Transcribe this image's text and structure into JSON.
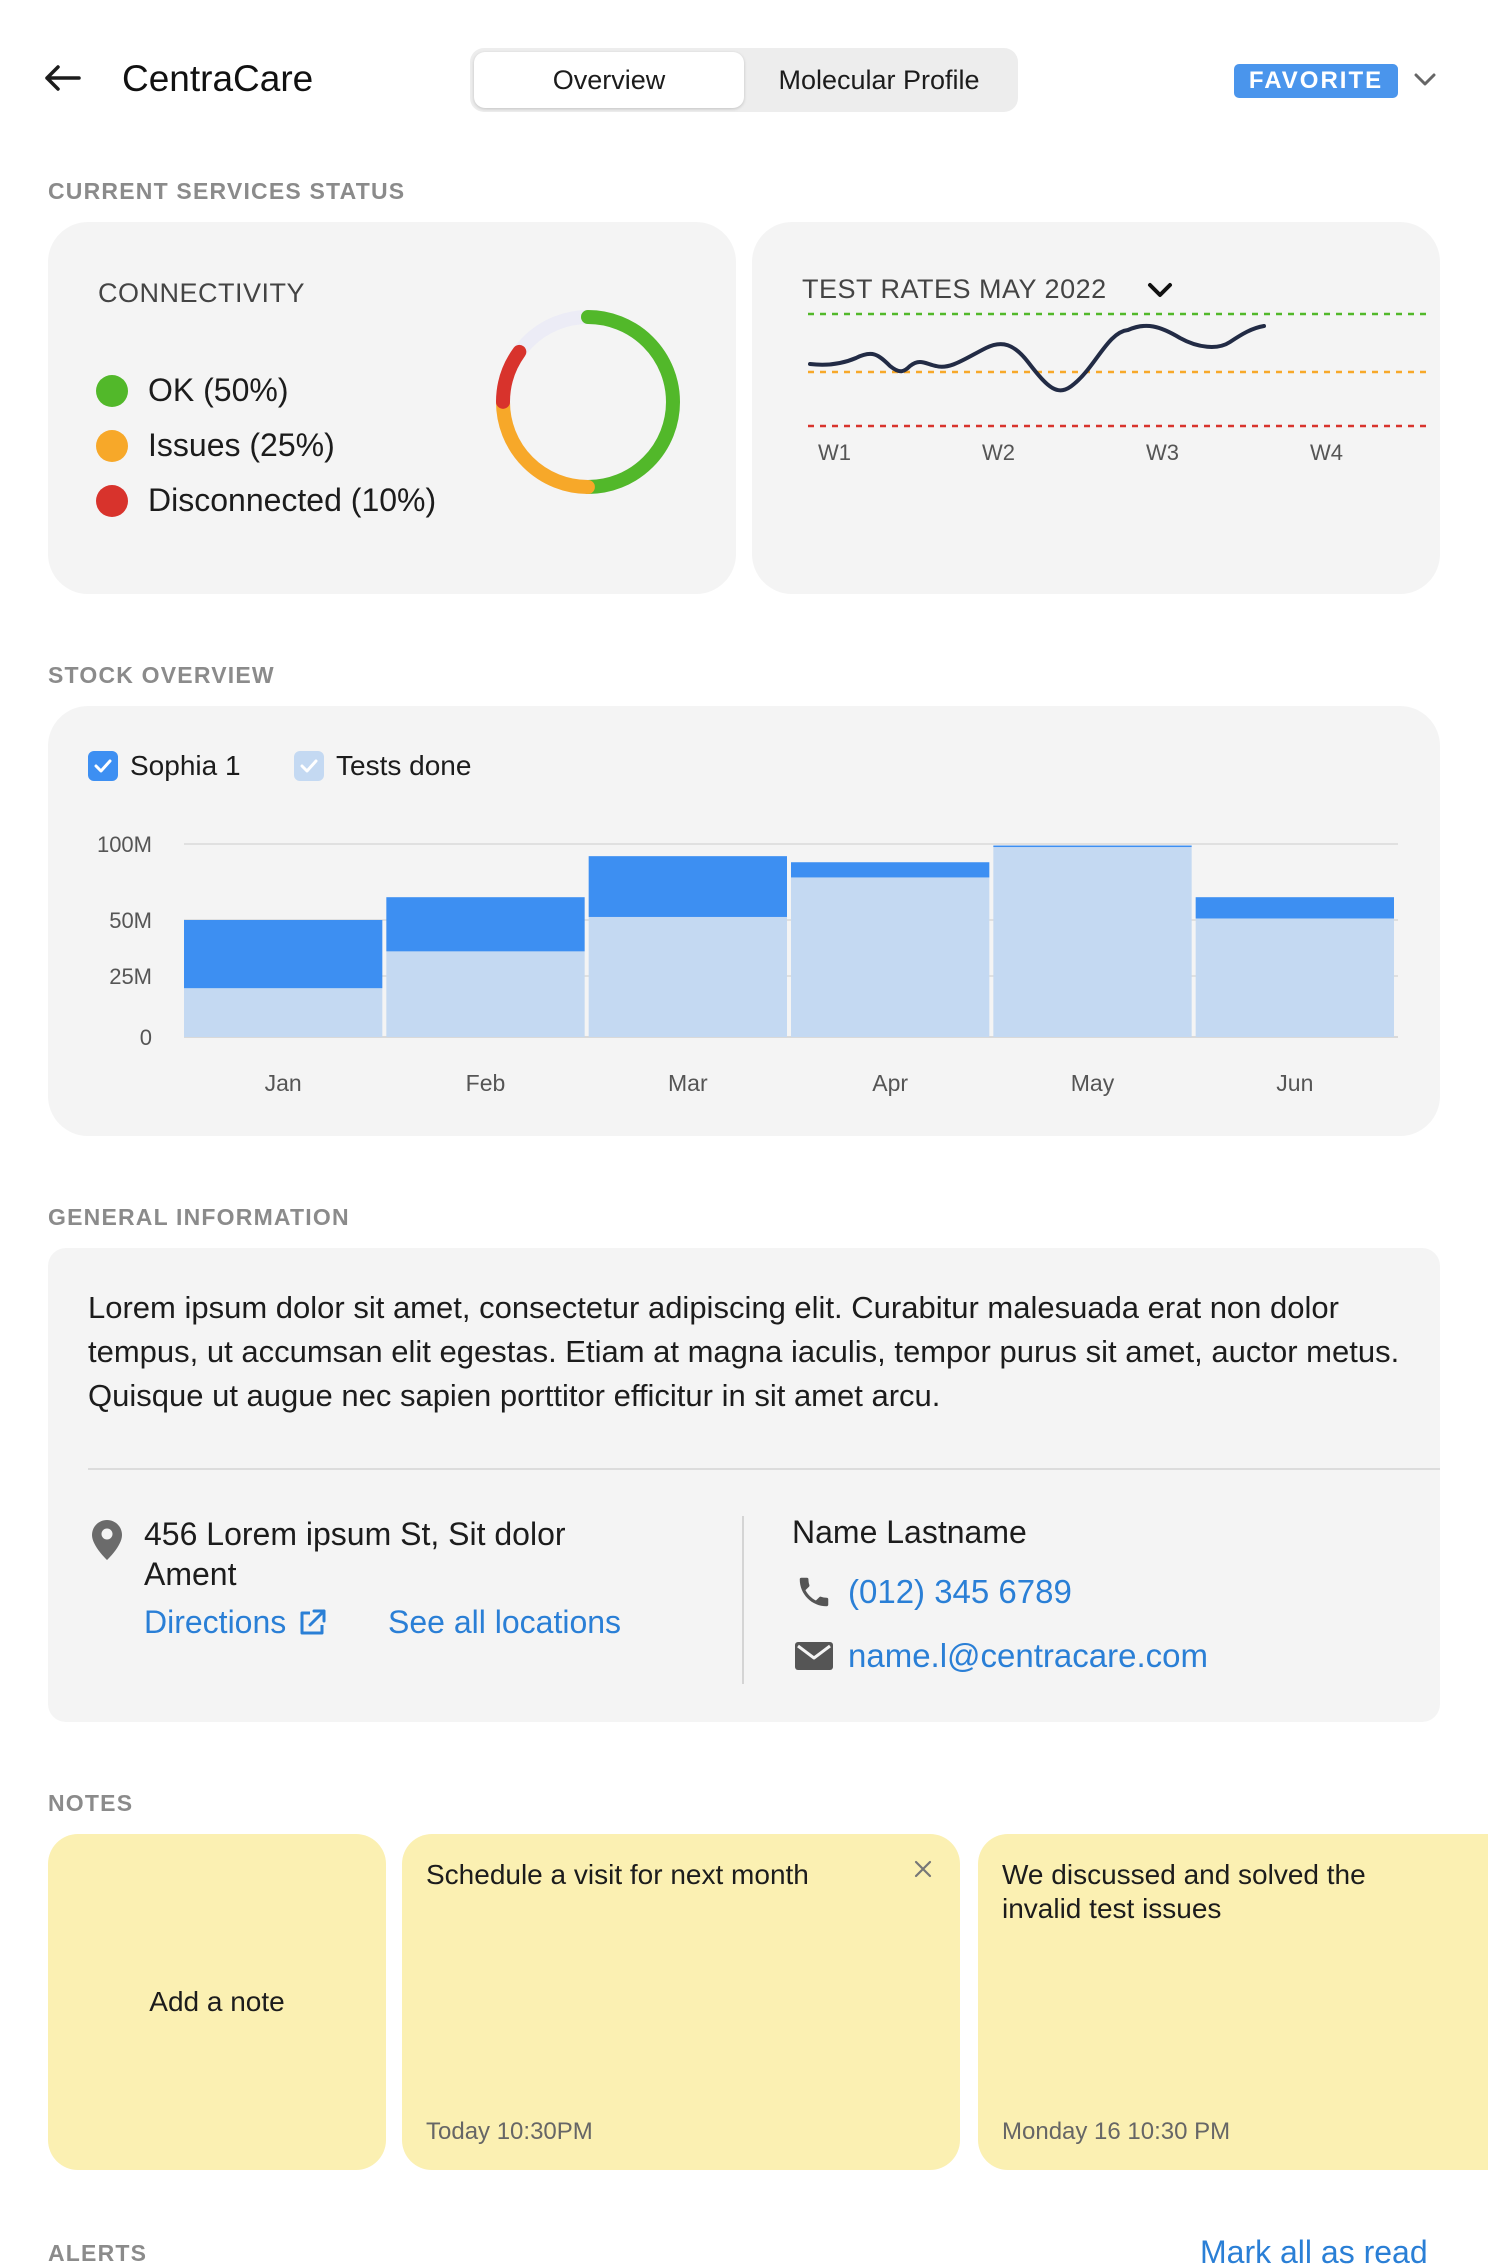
{
  "header": {
    "title": "CentraCare",
    "tabs": [
      {
        "label": "Overview",
        "active": true
      },
      {
        "label": "Molecular Profile",
        "active": false
      }
    ],
    "badge": "FAVORITE",
    "back_icon": "arrow-left-icon",
    "badge_menu_icon": "chevron-down-icon"
  },
  "sections": {
    "services": "CURRENT SERVICES STATUS",
    "stock": "STOCK OVERVIEW",
    "general": "GENERAL INFORMATION",
    "notes": "NOTES",
    "alerts": "ALERTS"
  },
  "connectivity": {
    "title": "CONNECTIVITY",
    "items": [
      {
        "label": "OK (50%)",
        "percent": 50,
        "color": "#52b82a"
      },
      {
        "label": "Issues (25%)",
        "percent": 25,
        "color": "#f7a829"
      },
      {
        "label": "Disconnected (10%)",
        "percent": 10,
        "color": "#d8332c"
      }
    ],
    "remainder_color": "#ececf6"
  },
  "test_rates": {
    "title": "TEST RATES MAY 2022",
    "weeks": [
      "W1",
      "W2",
      "W3",
      "W4"
    ],
    "thresholds": {
      "upper_color": "#52b82a",
      "middle_color": "#f7a829",
      "lower_color": "#d8332c"
    },
    "line_color": "#222b45"
  },
  "stock": {
    "legend": [
      {
        "label": "Sophia 1",
        "color": "#3d8ff2",
        "checked": true
      },
      {
        "label": "Tests done",
        "color": "#c4d9f2",
        "checked": true
      }
    ]
  },
  "chart_data": {
    "type": "bar",
    "stacked": true,
    "categories": [
      "Jan",
      "Feb",
      "Mar",
      "Apr",
      "May",
      "Jun"
    ],
    "series": [
      {
        "name": "Tests done",
        "values": [
          20,
          36,
          52,
          78,
          98,
          51
        ]
      },
      {
        "name": "Sophia 1",
        "values": [
          30,
          29,
          40,
          10,
          1,
          14
        ]
      }
    ],
    "y_ticks": [
      {
        "value": 0,
        "label": "0"
      },
      {
        "value": 25,
        "label": "25M"
      },
      {
        "value": 50,
        "label": "50M"
      },
      {
        "value": 100,
        "label": "100M"
      }
    ],
    "ylim": [
      0,
      100
    ],
    "colors": {
      "Sophia 1": "#3d8ff2",
      "Tests done": "#c4d9f2"
    }
  },
  "general_info": {
    "description": "Lorem ipsum dolor sit amet, consectetur adipiscing elit. Curabitur malesuada erat non dolor tempus, ut accumsan elit egestas. Etiam at magna iaculis, tempor purus sit amet, auctor metus. Quisque ut augue nec sapien porttitor efficitur in sit amet arcu.",
    "address": "456 Lorem ipsum St,  Sit dolor Ament",
    "directions_label": "Directions",
    "locations_label": "See all locations",
    "contact_name": "Name Lastname",
    "phone": "(012) 345 6789",
    "email": "name.l@centracare.com"
  },
  "notes": {
    "add_label": "Add a note",
    "items": [
      {
        "text": "Schedule a visit for next month",
        "time": "Today 10:30PM",
        "closable": true
      },
      {
        "text": "We discussed and solved the invalid test issues",
        "time": "Monday 16 10:30 PM",
        "closable": false
      }
    ]
  },
  "alerts": {
    "mark_all_label": "Mark all as read"
  }
}
